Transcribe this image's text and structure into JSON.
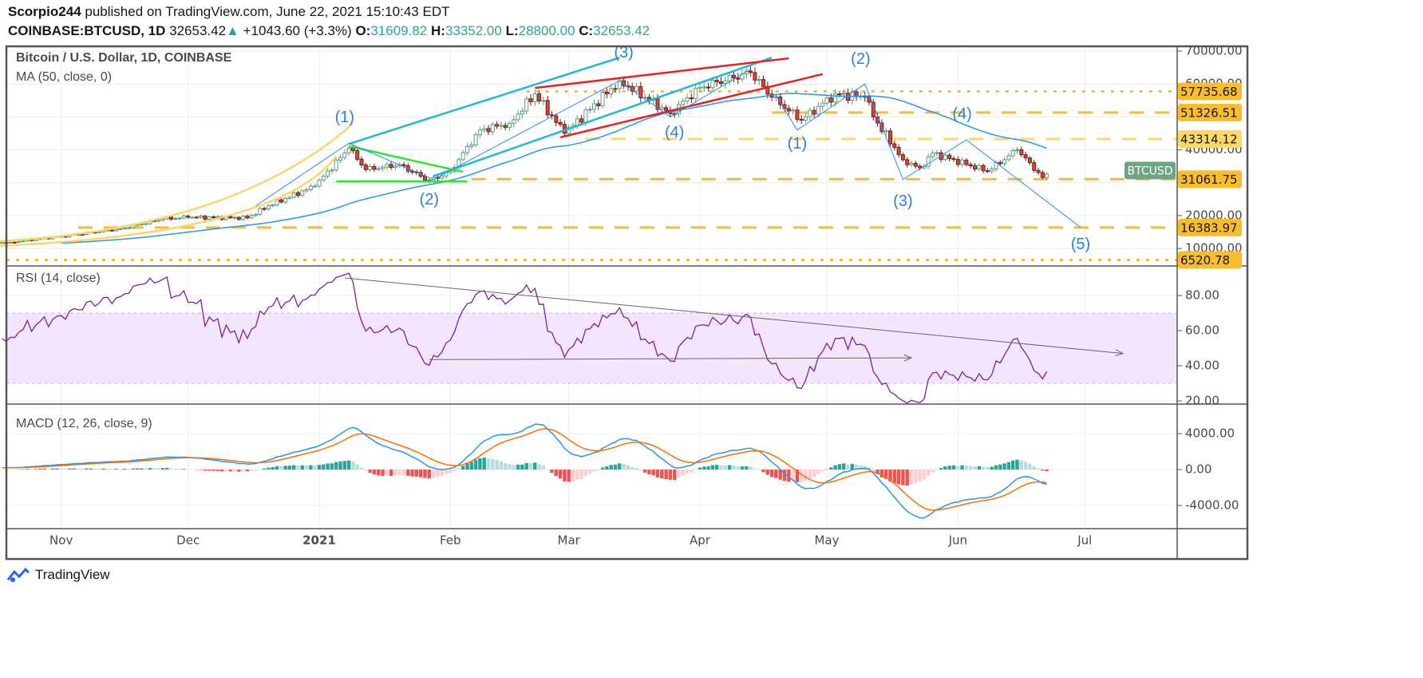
{
  "header": {
    "author": "Scorpio244",
    "published": " published on TradingView.com, June 22, 2021 15:10:43 EDT",
    "symbol": "COINBASE:BTCUSD, 1D",
    "last": "32653.42",
    "change": "+1043.60 (+3.3%)",
    "o_label": "O:",
    "o": "31609.82",
    "h_label": "H:",
    "h": "33352.00",
    "l_label": "L:",
    "l": "28800.00",
    "c_label": "C:",
    "c": "32653.42"
  },
  "legends": {
    "price": "Bitcoin / U.S. Dollar, 1D, COINBASE",
    "ma": "MA (50, close, 0)",
    "rsi": "RSI (14, close)",
    "macd": "MACD (12, 26, close, 9)"
  },
  "footer": {
    "brand": "TradingView"
  },
  "colors": {
    "up": "#26a69a",
    "down": "#d9473a",
    "ma": "#2196f3",
    "level": "#f9bd2b",
    "rsi": "#7b1fa2",
    "macd": "#2196f3",
    "signal": "#ff6d00"
  },
  "chart_data": {
    "type": "candlestick",
    "title": "Bitcoin / U.S. Dollar, 1D, COINBASE",
    "x_unit": "days from 2021-01-01",
    "close_keypoints": [
      [
        -110,
        10600
      ],
      [
        -73,
        11900
      ],
      [
        -61,
        13700
      ],
      [
        -47,
        16000
      ],
      [
        -37,
        19000
      ],
      [
        -31,
        19500
      ],
      [
        -17,
        19300
      ],
      [
        -12,
        23000
      ],
      [
        -1,
        29000
      ],
      [
        7,
        40500
      ],
      [
        11,
        34000
      ],
      [
        19,
        35500
      ],
      [
        26,
        30500
      ],
      [
        31,
        33500
      ],
      [
        38,
        46000
      ],
      [
        45,
        48000
      ],
      [
        51,
        57000
      ],
      [
        58,
        45000
      ],
      [
        71,
        61000
      ],
      [
        83,
        51000
      ],
      [
        90,
        59000
      ],
      [
        102,
        63500
      ],
      [
        107,
        56000
      ],
      [
        114,
        49000
      ],
      [
        122,
        57000
      ],
      [
        129,
        56000
      ],
      [
        131,
        50000
      ],
      [
        138,
        37000
      ],
      [
        142,
        34500
      ],
      [
        145,
        39000
      ],
      [
        158,
        33500
      ],
      [
        165,
        40000
      ],
      [
        171,
        31600
      ],
      [
        172,
        32653.42
      ]
    ],
    "price_axis": {
      "ticks": [
        "70000.00",
        "60000.00",
        "50000.00",
        "40000.00",
        "30000.00",
        "20000.00",
        "10000.00"
      ],
      "values": [
        70000,
        60000,
        50000,
        40000,
        30000,
        20000,
        10000
      ]
    },
    "time_axis": {
      "labels": [
        "Nov",
        "Dec",
        "2021",
        "Feb",
        "Mar",
        "Apr",
        "May",
        "Jun",
        "Jul"
      ],
      "days": [
        -61,
        -31,
        0,
        31,
        59,
        90,
        120,
        151,
        181
      ]
    },
    "levels": [
      {
        "label": "57735.68",
        "price": 57735.68,
        "style": "dotted",
        "from": 49,
        "color": "#f9bd2b"
      },
      {
        "label": "51326.51",
        "price": 51326.51,
        "style": "dashed",
        "from": 107,
        "color": "#f9bd2b"
      },
      {
        "label": "43314.12",
        "price": 43314.12,
        "style": "dashed-light",
        "from": 63,
        "color": "#fdd866"
      },
      {
        "label": "31061.75",
        "price": 31061.75,
        "style": "dashed",
        "from": 36,
        "color": "#f9bd2b"
      },
      {
        "label": "16383.97",
        "price": 16383.97,
        "style": "dashed",
        "from": -57,
        "color": "#f9bd2b"
      },
      {
        "label": "6520.78",
        "price": 6520.78,
        "style": "dotted",
        "from": -75,
        "color": "#f9bd2b"
      }
    ],
    "price_tag": "BTCUSD",
    "wave_labels": [
      {
        "t": "(1)",
        "d": 6,
        "p": 48400
      },
      {
        "t": "(2)",
        "d": 26,
        "p": 23400
      },
      {
        "t": "(3)",
        "d": 72,
        "p": 68000
      },
      {
        "t": "(4)",
        "d": 84,
        "p": 43800
      },
      {
        "t": "(1)",
        "d": 113,
        "p": 40400
      },
      {
        "t": "(2)",
        "d": 128,
        "p": 66100
      },
      {
        "t": "(3)",
        "d": 138,
        "p": 22900
      },
      {
        "t": "(4)",
        "d": 152,
        "p": 49400
      },
      {
        "t": "(5)",
        "d": 180,
        "p": 9800
      }
    ],
    "trendlines": [
      {
        "c": "#1fb8d8",
        "w": 2.5,
        "pts": [
          [
            7,
            41800
          ],
          [
            71,
            68000
          ]
        ]
      },
      {
        "c": "#1fb8d8",
        "w": 2.5,
        "pts": [
          [
            27,
            32000
          ],
          [
            107,
            68000
          ]
        ]
      },
      {
        "c": "#f21b1b",
        "w": 2.5,
        "pts": [
          [
            51,
            58800
          ],
          [
            111,
            67800
          ]
        ]
      },
      {
        "c": "#f21b1b",
        "w": 2.5,
        "pts": [
          [
            57,
            43800
          ],
          [
            119,
            63000
          ]
        ]
      },
      {
        "c": "#2ee52e",
        "w": 2.5,
        "pts": [
          [
            4,
            30400
          ],
          [
            35,
            30400
          ]
        ]
      },
      {
        "c": "#2ee52e",
        "w": 2.5,
        "pts": [
          [
            7,
            41100
          ],
          [
            34,
            33300
          ]
        ]
      },
      {
        "c": "#2a8ee8",
        "w": 1,
        "pts": [
          [
            -15,
            23000
          ],
          [
            7,
            42000
          ],
          [
            27,
            31000
          ],
          [
            71,
            61000
          ],
          [
            83,
            50000
          ],
          [
            102,
            64500
          ]
        ]
      },
      {
        "c": "#2a8ee8",
        "w": 1,
        "pts": [
          [
            108,
            56500
          ],
          [
            113,
            46000
          ],
          [
            129,
            60000
          ],
          [
            138,
            31000
          ],
          [
            153,
            43000
          ],
          [
            180,
            16400
          ]
        ]
      }
    ],
    "curves": [
      {
        "c": "#fbd46a",
        "pts": [
          [
            -76,
            12200
          ],
          [
            -20,
            16000
          ],
          [
            8,
            48000
          ]
        ]
      },
      {
        "c": "#fbd46a",
        "pts": [
          [
            -76,
            10800
          ],
          [
            -10,
            14500
          ],
          [
            4,
            38000
          ]
        ]
      }
    ],
    "rsi": {
      "ticks": [
        "80.00",
        "60.00",
        "40.00",
        "20.00"
      ],
      "values": [
        80,
        60,
        40,
        20
      ],
      "band": [
        30,
        70
      ],
      "lines": [
        {
          "pts": [
            [
              6,
              90
            ],
            [
              190,
              47
            ]
          ]
        },
        {
          "pts": [
            [
              26,
              43.5
            ],
            [
              140,
              44.5
            ]
          ]
        }
      ]
    },
    "macd": {
      "ticks": [
        "4000.00",
        "0.00",
        "-4000.00"
      ],
      "values": [
        4000,
        0,
        -4000
      ]
    }
  }
}
